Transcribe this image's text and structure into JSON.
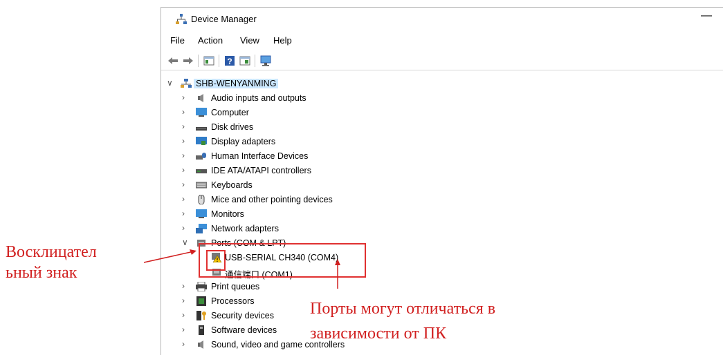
{
  "window": {
    "title": "Device Manager",
    "minimize_glyph": "—"
  },
  "menu": [
    "File",
    "Action",
    "View",
    "Help"
  ],
  "toolbar_icons": [
    "back-arrow-icon",
    "forward-arrow-icon",
    "properties-icon",
    "help-icon",
    "update-driver-icon",
    "scan-hardware-icon"
  ],
  "tree": {
    "root": "SHB-WENYANMING",
    "items": [
      {
        "label": "Audio inputs and outputs",
        "icon": "speaker-icon"
      },
      {
        "label": "Computer",
        "icon": "computer-icon"
      },
      {
        "label": "Disk drives",
        "icon": "disk-drive-icon"
      },
      {
        "label": "Display adapters",
        "icon": "display-adapter-icon"
      },
      {
        "label": "Human Interface Devices",
        "icon": "hid-icon"
      },
      {
        "label": "IDE ATA/ATAPI controllers",
        "icon": "ide-controller-icon"
      },
      {
        "label": "Keyboards",
        "icon": "keyboard-icon"
      },
      {
        "label": "Mice and other pointing devices",
        "icon": "mouse-icon"
      },
      {
        "label": "Monitors",
        "icon": "monitor-icon"
      },
      {
        "label": "Network adapters",
        "icon": "network-adapter-icon"
      },
      {
        "label": "Ports (COM & LPT)",
        "icon": "port-icon"
      },
      {
        "label": "USB-SERIAL CH340 (COM4)",
        "icon": "warning-port-icon"
      },
      {
        "label": "通信端口 (COM1)",
        "icon": "port-icon"
      },
      {
        "label": "Print queues",
        "icon": "printer-icon"
      },
      {
        "label": "Processors",
        "icon": "processor-icon"
      },
      {
        "label": "Security devices",
        "icon": "security-key-icon"
      },
      {
        "label": "Software devices",
        "icon": "software-device-icon"
      },
      {
        "label": "Sound, video and game controllers",
        "icon": "speaker-icon"
      }
    ]
  },
  "annotations": {
    "exclamation_line1": "Восклицател",
    "exclamation_line2": "ьный знак",
    "ports_line1": "Порты могут отличаться в",
    "ports_line2": "зависимости от ПК"
  },
  "colors": {
    "annotation_red": "#d12020",
    "selection": "#cce8ff"
  }
}
